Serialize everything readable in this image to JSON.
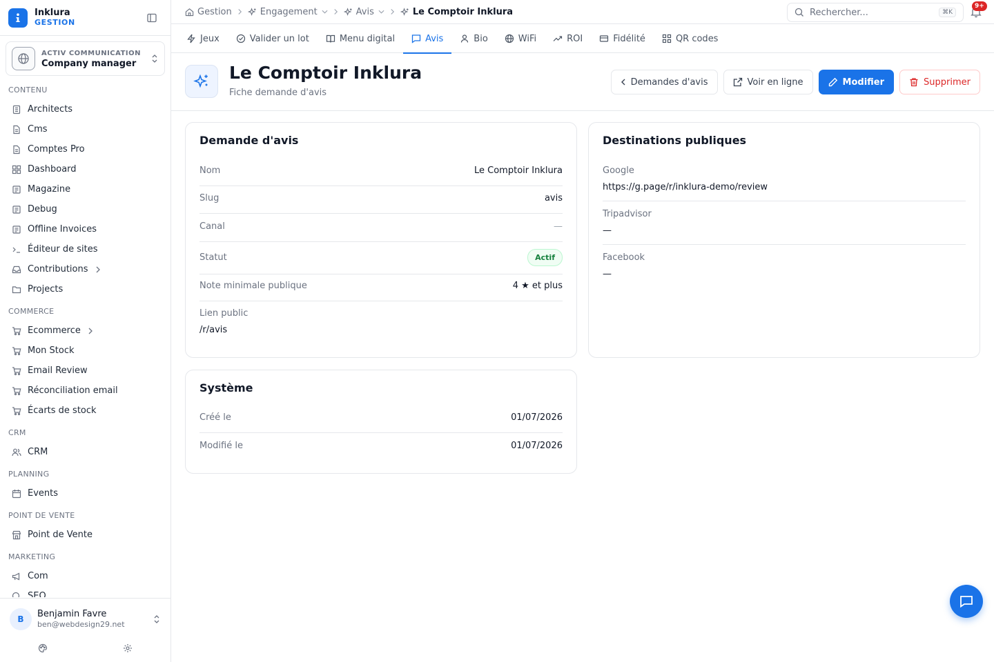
{
  "brand": {
    "name": "Inklura",
    "sub": "GESTION"
  },
  "org": {
    "sub": "ACTIV COMMUNICATION",
    "name": "Company manager"
  },
  "nav": {
    "contenu": {
      "title": "CONTENU",
      "items": [
        {
          "label": "Architects"
        },
        {
          "label": "Cms"
        },
        {
          "label": "Comptes Pro"
        },
        {
          "label": "Dashboard"
        },
        {
          "label": "Magazine"
        },
        {
          "label": "Debug"
        },
        {
          "label": "Offline Invoices"
        },
        {
          "label": "Éditeur de sites"
        },
        {
          "label": "Contributions"
        },
        {
          "label": "Projects"
        }
      ]
    },
    "commerce": {
      "title": "COMMERCE",
      "items": [
        {
          "label": "Ecommerce"
        },
        {
          "label": "Mon Stock"
        },
        {
          "label": "Email Review"
        },
        {
          "label": "Réconciliation email"
        },
        {
          "label": "Écarts de stock"
        }
      ]
    },
    "crm": {
      "title": "CRM",
      "items": [
        {
          "label": "CRM"
        }
      ]
    },
    "planning": {
      "title": "PLANNING",
      "items": [
        {
          "label": "Events"
        }
      ]
    },
    "pdv": {
      "title": "POINT DE VENTE",
      "items": [
        {
          "label": "Point de Vente"
        }
      ]
    },
    "marketing": {
      "title": "MARKETING",
      "items": [
        {
          "label": "Com"
        },
        {
          "label": "SEO"
        }
      ]
    }
  },
  "user": {
    "initial": "B",
    "name": "Benjamin Favre",
    "email": "ben@webdesign29.net"
  },
  "breadcrumb": {
    "home": "Gestion",
    "level1": "Engagement",
    "level2": "Avis",
    "current": "Le Comptoir Inklura"
  },
  "search": {
    "placeholder": "Rechercher...",
    "shortcut": "⌘K"
  },
  "notifications": {
    "badge": "9+"
  },
  "tabs": [
    {
      "label": "Jeux"
    },
    {
      "label": "Valider un lot"
    },
    {
      "label": "Menu digital"
    },
    {
      "label": "Avis"
    },
    {
      "label": "Bio"
    },
    {
      "label": "WiFi"
    },
    {
      "label": "ROI"
    },
    {
      "label": "Fidélité"
    },
    {
      "label": "QR codes"
    }
  ],
  "header": {
    "title": "Le Comptoir Inklura",
    "subtitle": "Fiche demande d'avis",
    "actions": {
      "back": "Demandes d'avis",
      "view": "Voir en ligne",
      "edit": "Modifier",
      "delete": "Supprimer"
    }
  },
  "review_card": {
    "title": "Demande d'avis",
    "rows": {
      "name": {
        "label": "Nom",
        "value": "Le Comptoir Inklura"
      },
      "slug": {
        "label": "Slug",
        "value": "avis"
      },
      "channel": {
        "label": "Canal",
        "value": "—"
      },
      "status": {
        "label": "Statut",
        "value": "Actif"
      },
      "min_rating": {
        "label": "Note minimale publique",
        "value": "4 ★ et plus"
      },
      "public_link": {
        "label": "Lien public",
        "value": "/r/avis"
      }
    }
  },
  "destinations_card": {
    "title": "Destinations publiques",
    "google": {
      "label": "Google",
      "value": "https://g.page/r/inklura-demo/review"
    },
    "tripadvisor": {
      "label": "Tripadvisor",
      "value": "—"
    },
    "facebook": {
      "label": "Facebook",
      "value": "—"
    }
  },
  "system_card": {
    "title": "Système",
    "created": {
      "label": "Créé le",
      "value": "01/07/2026"
    },
    "modified": {
      "label": "Modifié le",
      "value": "01/07/2026"
    }
  },
  "colors": {
    "accent": "#1a73e8",
    "danger": "#dc2626",
    "success": "#15803d"
  }
}
